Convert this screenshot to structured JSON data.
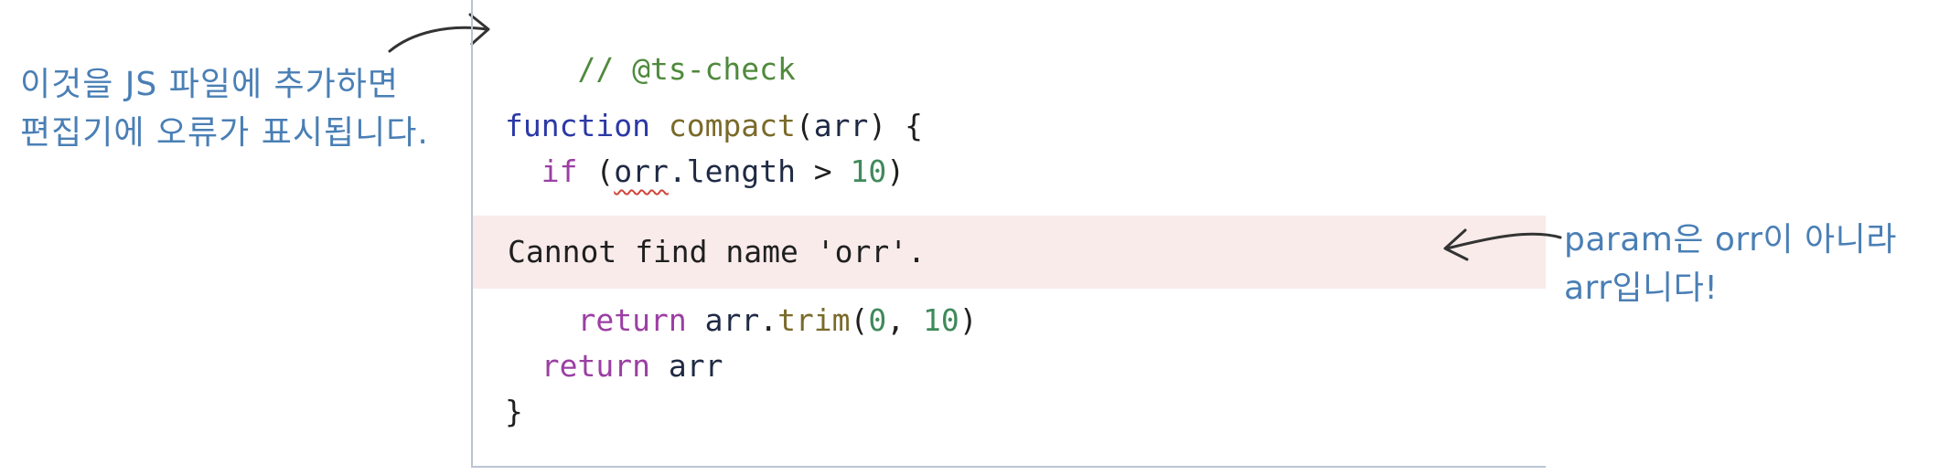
{
  "annotations": {
    "left_line1": "이것을 JS 파일에 추가하면",
    "left_line2": "편집기에 오류가 표시됩니다.",
    "right_line1": "param은 orr이 아니라",
    "right_line2": "arr입니다!"
  },
  "code": {
    "comment": "// @ts-check",
    "line2": {
      "keyword": "function",
      "name": "compact",
      "open": "(",
      "param": "arr",
      "close": ") {"
    },
    "line3": {
      "keyword": "if",
      "open": "(",
      "error_ident": "orr",
      "prop": ".length",
      "op": " > ",
      "number": "10",
      "close": ")"
    },
    "line5": {
      "keyword": "return",
      "ident": "arr",
      "dot": ".",
      "method": "trim",
      "open": "(",
      "arg1": "0",
      "sep": ", ",
      "arg2": "10",
      "close": ")"
    },
    "line6": {
      "keyword": "return",
      "ident": "arr"
    },
    "line7": "}"
  },
  "error": {
    "message": "Cannot find name 'orr'."
  },
  "colors": {
    "annotation": "#4a7fb5",
    "error_background": "#f8ebea",
    "squiggle": "#d0453a"
  },
  "icons": [
    "arrow-to-comment-icon",
    "arrow-to-error-icon"
  ]
}
